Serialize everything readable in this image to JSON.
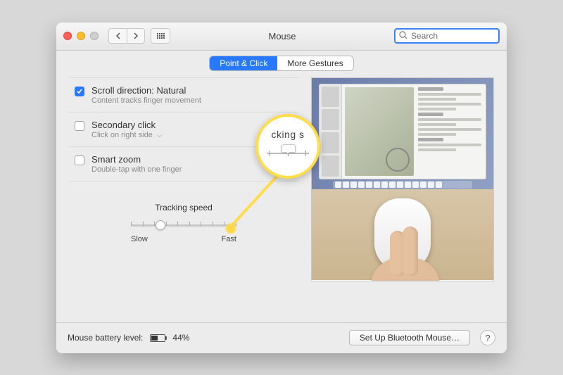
{
  "window": {
    "title": "Mouse"
  },
  "toolbar": {
    "search_placeholder": "Search"
  },
  "tabs": {
    "point_click": "Point & Click",
    "more_gestures": "More Gestures"
  },
  "options": {
    "scroll": {
      "title": "Scroll direction: Natural",
      "sub": "Content tracks finger movement",
      "checked": true
    },
    "secondary": {
      "title": "Secondary click",
      "sub": "Click on right side",
      "checked": false
    },
    "smartzoom": {
      "title": "Smart zoom",
      "sub": "Double-tap with one finger",
      "checked": false
    }
  },
  "tracking": {
    "label": "Tracking speed",
    "slow": "Slow",
    "fast": "Fast"
  },
  "bottom": {
    "battery_label": "Mouse battery level:",
    "battery_value": "44%",
    "bluetooth_btn": "Set Up Bluetooth Mouse…",
    "help": "?"
  },
  "callout": {
    "text": "cking s"
  }
}
